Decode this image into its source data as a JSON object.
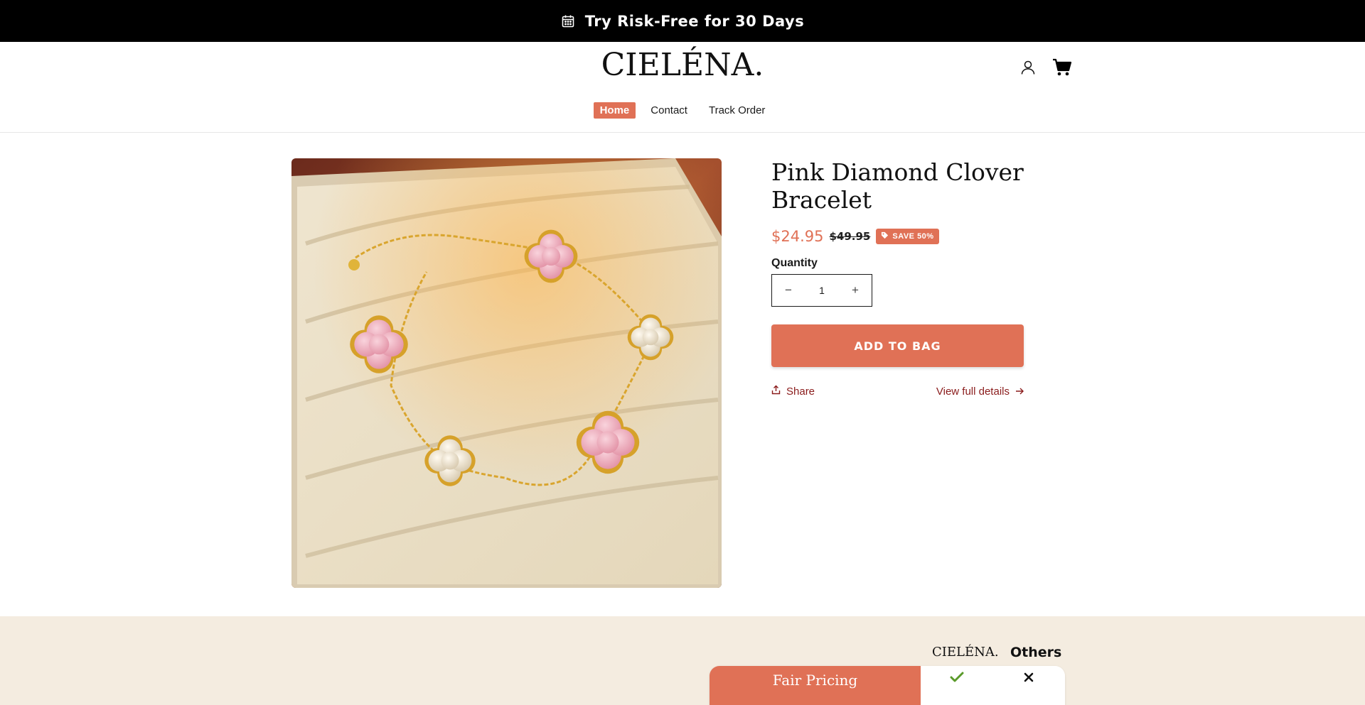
{
  "announcement": {
    "text": "Try Risk-Free for 30 Days",
    "icon": "calendar-icon"
  },
  "header": {
    "logo": "CIELÉNA.",
    "icons": [
      "account-icon",
      "cart-icon"
    ],
    "nav": [
      {
        "label": "Home",
        "active": true
      },
      {
        "label": "Contact",
        "active": false
      },
      {
        "label": "Track Order",
        "active": false
      }
    ]
  },
  "product": {
    "title": "Pink Diamond Clover Bracelet",
    "price": "$24.95",
    "compare_price": "$49.95",
    "badge": "SAVE 50%",
    "quantity_label": "Quantity",
    "quantity_value": "1",
    "add_to_bag": "ADD TO BAG",
    "share": "Share",
    "view_details": "View full details"
  },
  "comparison": {
    "brand": "CIELÉNA.",
    "others": "Others",
    "rows": [
      {
        "feature": "Fair Pricing",
        "brand": "check-icon",
        "others": "x-icon"
      }
    ]
  },
  "colors": {
    "accent": "#e07156",
    "link": "#8a1b1b",
    "section_bg": "#f4ece0"
  }
}
